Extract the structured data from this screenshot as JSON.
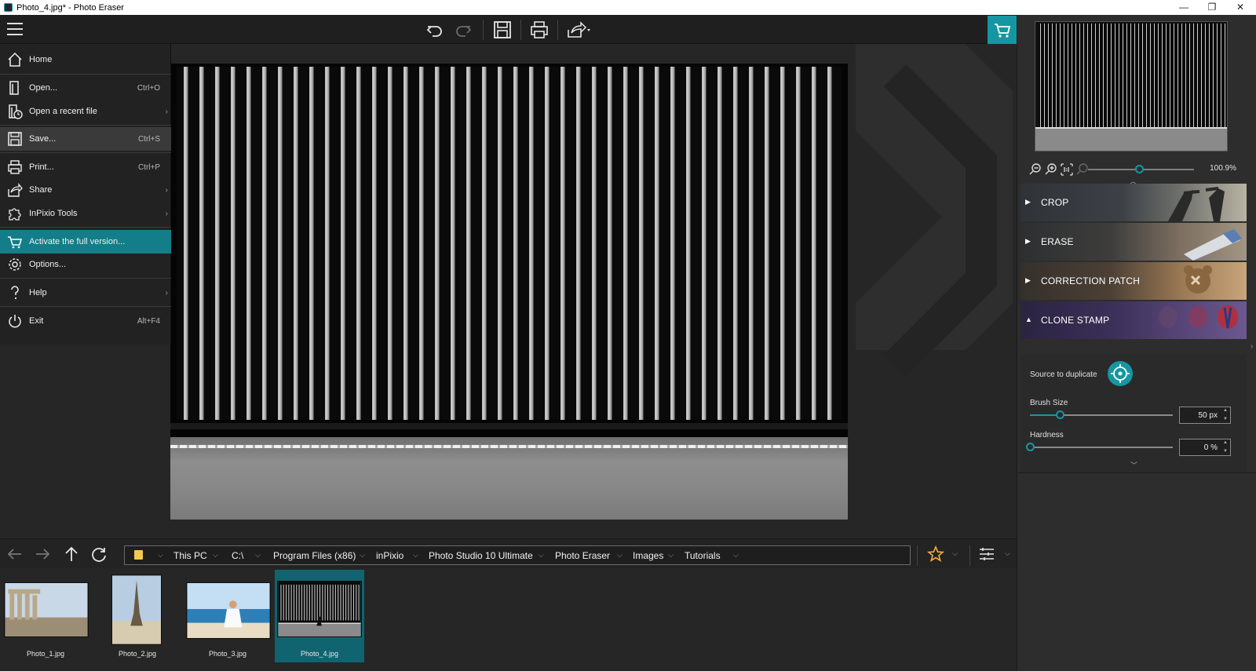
{
  "window": {
    "title": "Photo_4.jpg* - Photo Eraser",
    "controls": {
      "minimize": "—",
      "maximize": "❐",
      "close": "✕"
    }
  },
  "toolbar": {
    "icons": [
      "menu-icon",
      "undo-icon",
      "redo-icon",
      "save-icon",
      "print-icon",
      "share-icon",
      "cart-icon"
    ]
  },
  "menu": {
    "items": [
      {
        "label": "Home",
        "shortcut": "",
        "icon": "home-icon",
        "submenu": false
      },
      {
        "label": "Open...",
        "shortcut": "Ctrl+O",
        "icon": "open-icon",
        "submenu": false
      },
      {
        "label": "Open a recent file",
        "shortcut": "",
        "icon": "recent-file-icon",
        "submenu": true
      },
      {
        "label": "Save...",
        "shortcut": "Ctrl+S",
        "icon": "save-icon",
        "submenu": false
      },
      {
        "label": "Print...",
        "shortcut": "Ctrl+P",
        "icon": "print-icon",
        "submenu": false
      },
      {
        "label": "Share",
        "shortcut": "",
        "icon": "share-icon",
        "submenu": true
      },
      {
        "label": "InPixio Tools",
        "shortcut": "",
        "icon": "puzzle-icon",
        "submenu": true
      },
      {
        "label": "Activate the full version...",
        "shortcut": "",
        "icon": "cart-icon",
        "submenu": false
      },
      {
        "label": "Options...",
        "shortcut": "",
        "icon": "gear-icon",
        "submenu": false
      },
      {
        "label": "Help",
        "shortcut": "",
        "icon": "help-icon",
        "submenu": true
      },
      {
        "label": "Exit",
        "shortcut": "Alt+F4",
        "icon": "power-icon",
        "submenu": false
      }
    ],
    "hovered": "Save...",
    "highlighted": "Activate the full version..."
  },
  "pathbar": {
    "crumbs": [
      "This PC",
      "C:\\",
      "Program Files (x86)",
      "inPixio",
      "Photo Studio 10 Ultimate",
      "Photo Eraser",
      "Images",
      "Tutorials"
    ]
  },
  "thumbnails": [
    {
      "name": "Photo_1.jpg",
      "selected": false
    },
    {
      "name": "Photo_2.jpg",
      "selected": false
    },
    {
      "name": "Photo_3.jpg",
      "selected": false
    },
    {
      "name": "Photo_4.jpg",
      "selected": true
    }
  ],
  "navigator": {
    "zoom": "100.9%",
    "zoom_fraction": 0.48
  },
  "tools": [
    {
      "name": "CROP",
      "expanded": false
    },
    {
      "name": "ERASE",
      "expanded": false
    },
    {
      "name": "CORRECTION PATCH",
      "expanded": false
    },
    {
      "name": "CLONE STAMP",
      "expanded": true
    }
  ],
  "clone_stamp": {
    "source_label": "Source to duplicate",
    "brush_label": "Brush Size",
    "brush_value": "50 px",
    "brush_fraction": 0.21,
    "hardness_label": "Hardness",
    "hardness_value": "0 %",
    "hardness_fraction": 0.0
  },
  "colors": {
    "accent": "#1497a3",
    "highlight": "#137e89",
    "background": "#262626",
    "panel": "#2d2d2d"
  }
}
